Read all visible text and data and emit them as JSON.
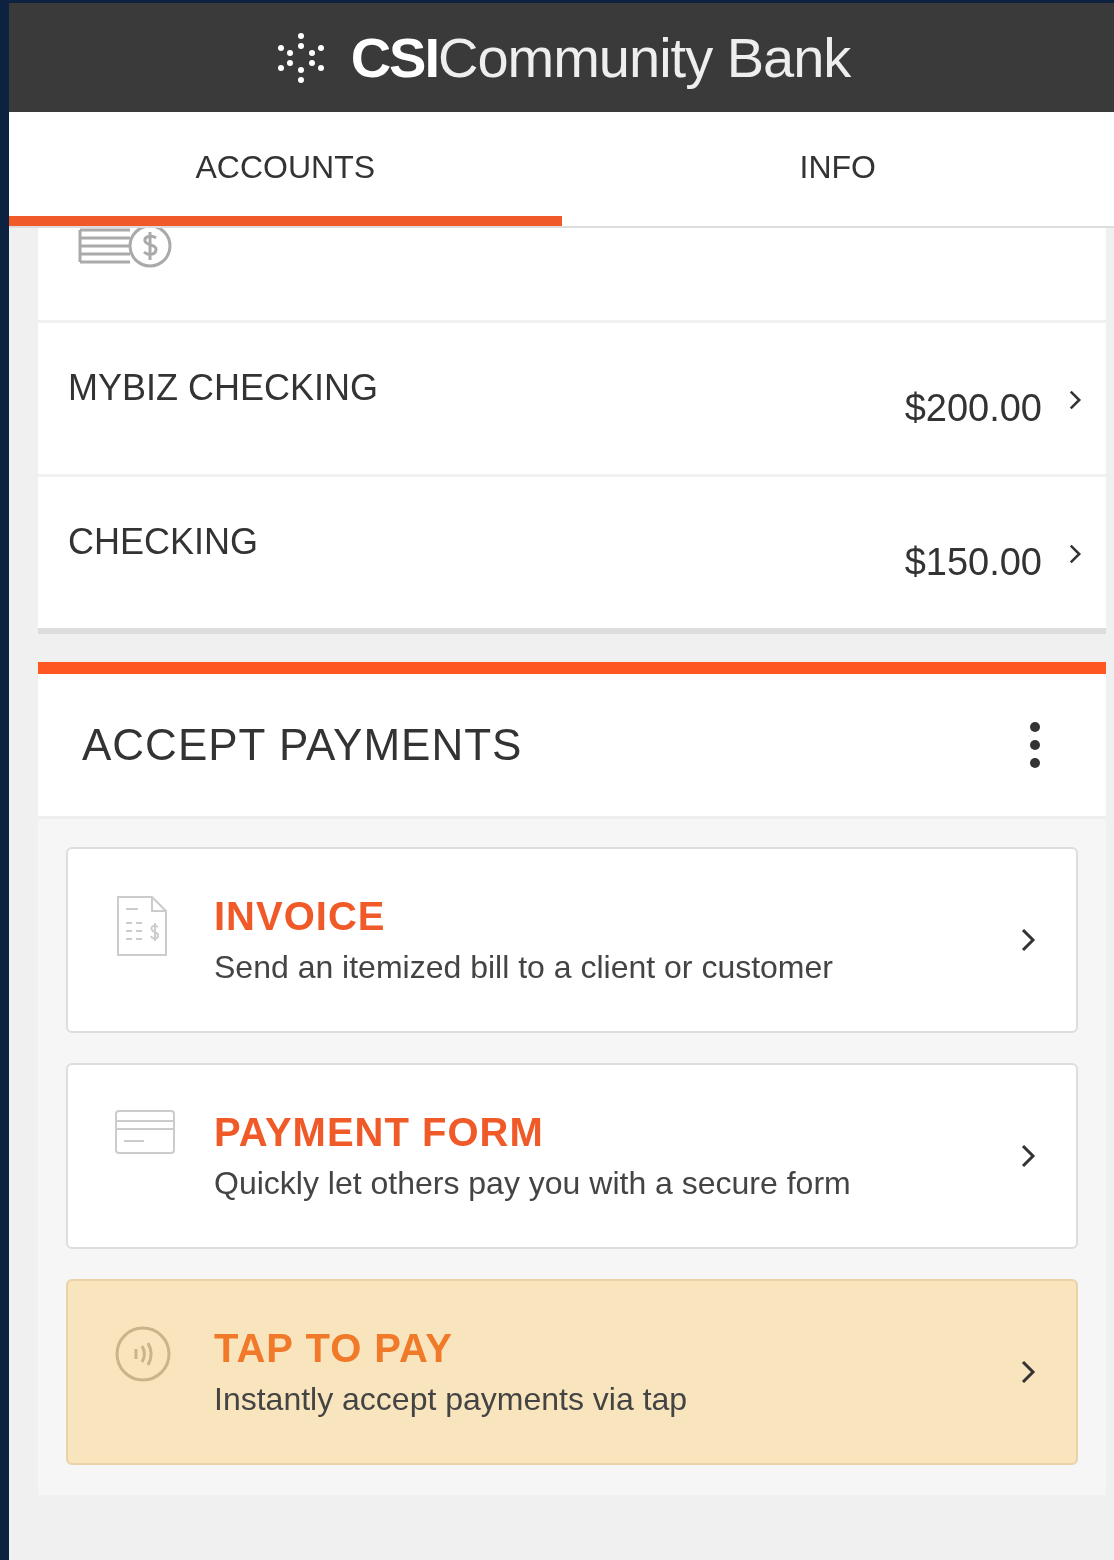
{
  "header": {
    "logo_strong": "CSI",
    "logo_light": "Community Bank"
  },
  "tabs": [
    {
      "label": "ACCOUNTS",
      "selected": true
    },
    {
      "label": "INFO",
      "selected": false
    }
  ],
  "accounts": [
    {
      "name": "MYBIZ CHECKING",
      "balance": "$200.00"
    },
    {
      "name": "CHECKING",
      "balance": "$150.00"
    }
  ],
  "accept_payments": {
    "title": "ACCEPT PAYMENTS",
    "options": [
      {
        "kind": "invoice",
        "title": "INVOICE",
        "description": "Send an itemized bill to a client or customer",
        "highlighted": false
      },
      {
        "kind": "form",
        "title": "PAYMENT FORM",
        "description": "Quickly let others pay you with a secure form",
        "highlighted": false
      },
      {
        "kind": "tap",
        "title": "TAP TO PAY",
        "description": "Instantly accept payments via tap",
        "highlighted": true
      }
    ]
  }
}
